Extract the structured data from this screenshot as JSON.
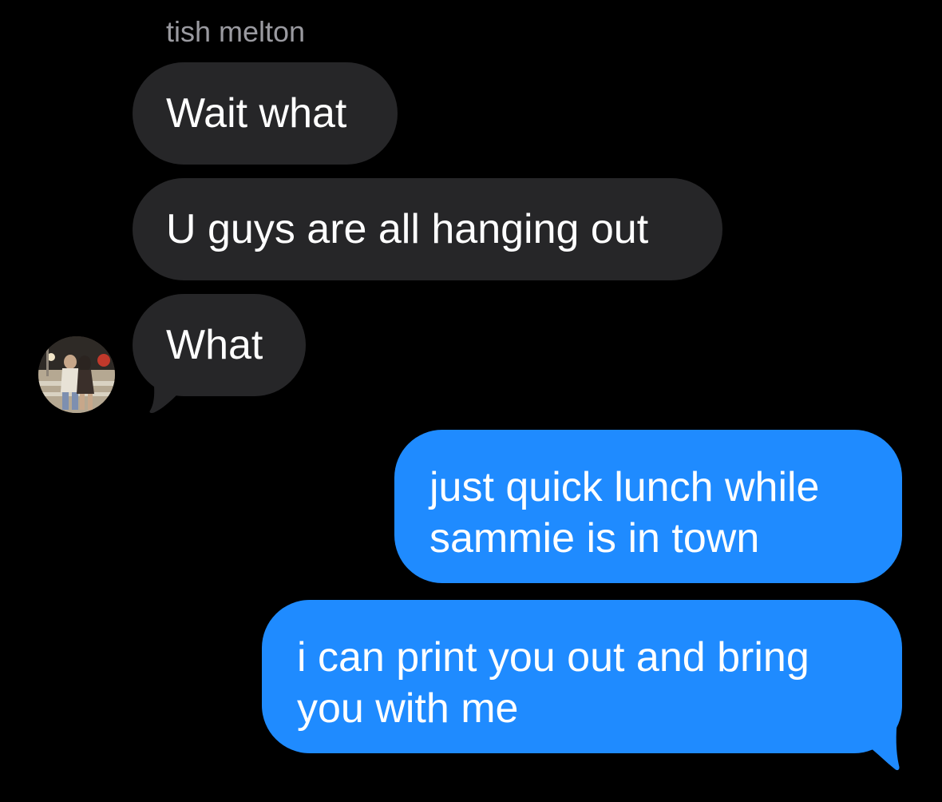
{
  "conversation": {
    "sender_name": "tish melton",
    "messages": [
      {
        "direction": "incoming",
        "text": "Wait what"
      },
      {
        "direction": "incoming",
        "text": "U guys are all hanging out"
      },
      {
        "direction": "incoming",
        "text": "What"
      },
      {
        "direction": "outgoing",
        "lines": [
          "just quick lunch while",
          "sammie is in town"
        ]
      },
      {
        "direction": "outgoing",
        "lines": [
          "i can print you out and bring",
          "you with me"
        ]
      }
    ]
  },
  "colors": {
    "background": "#000000",
    "incoming_bubble": "#262628",
    "outgoing_bubble": "#1f8bff",
    "sender_name": "#9a9aa0",
    "text": "#ffffff"
  },
  "avatar": {
    "icon": "contact-photo-avatar"
  }
}
